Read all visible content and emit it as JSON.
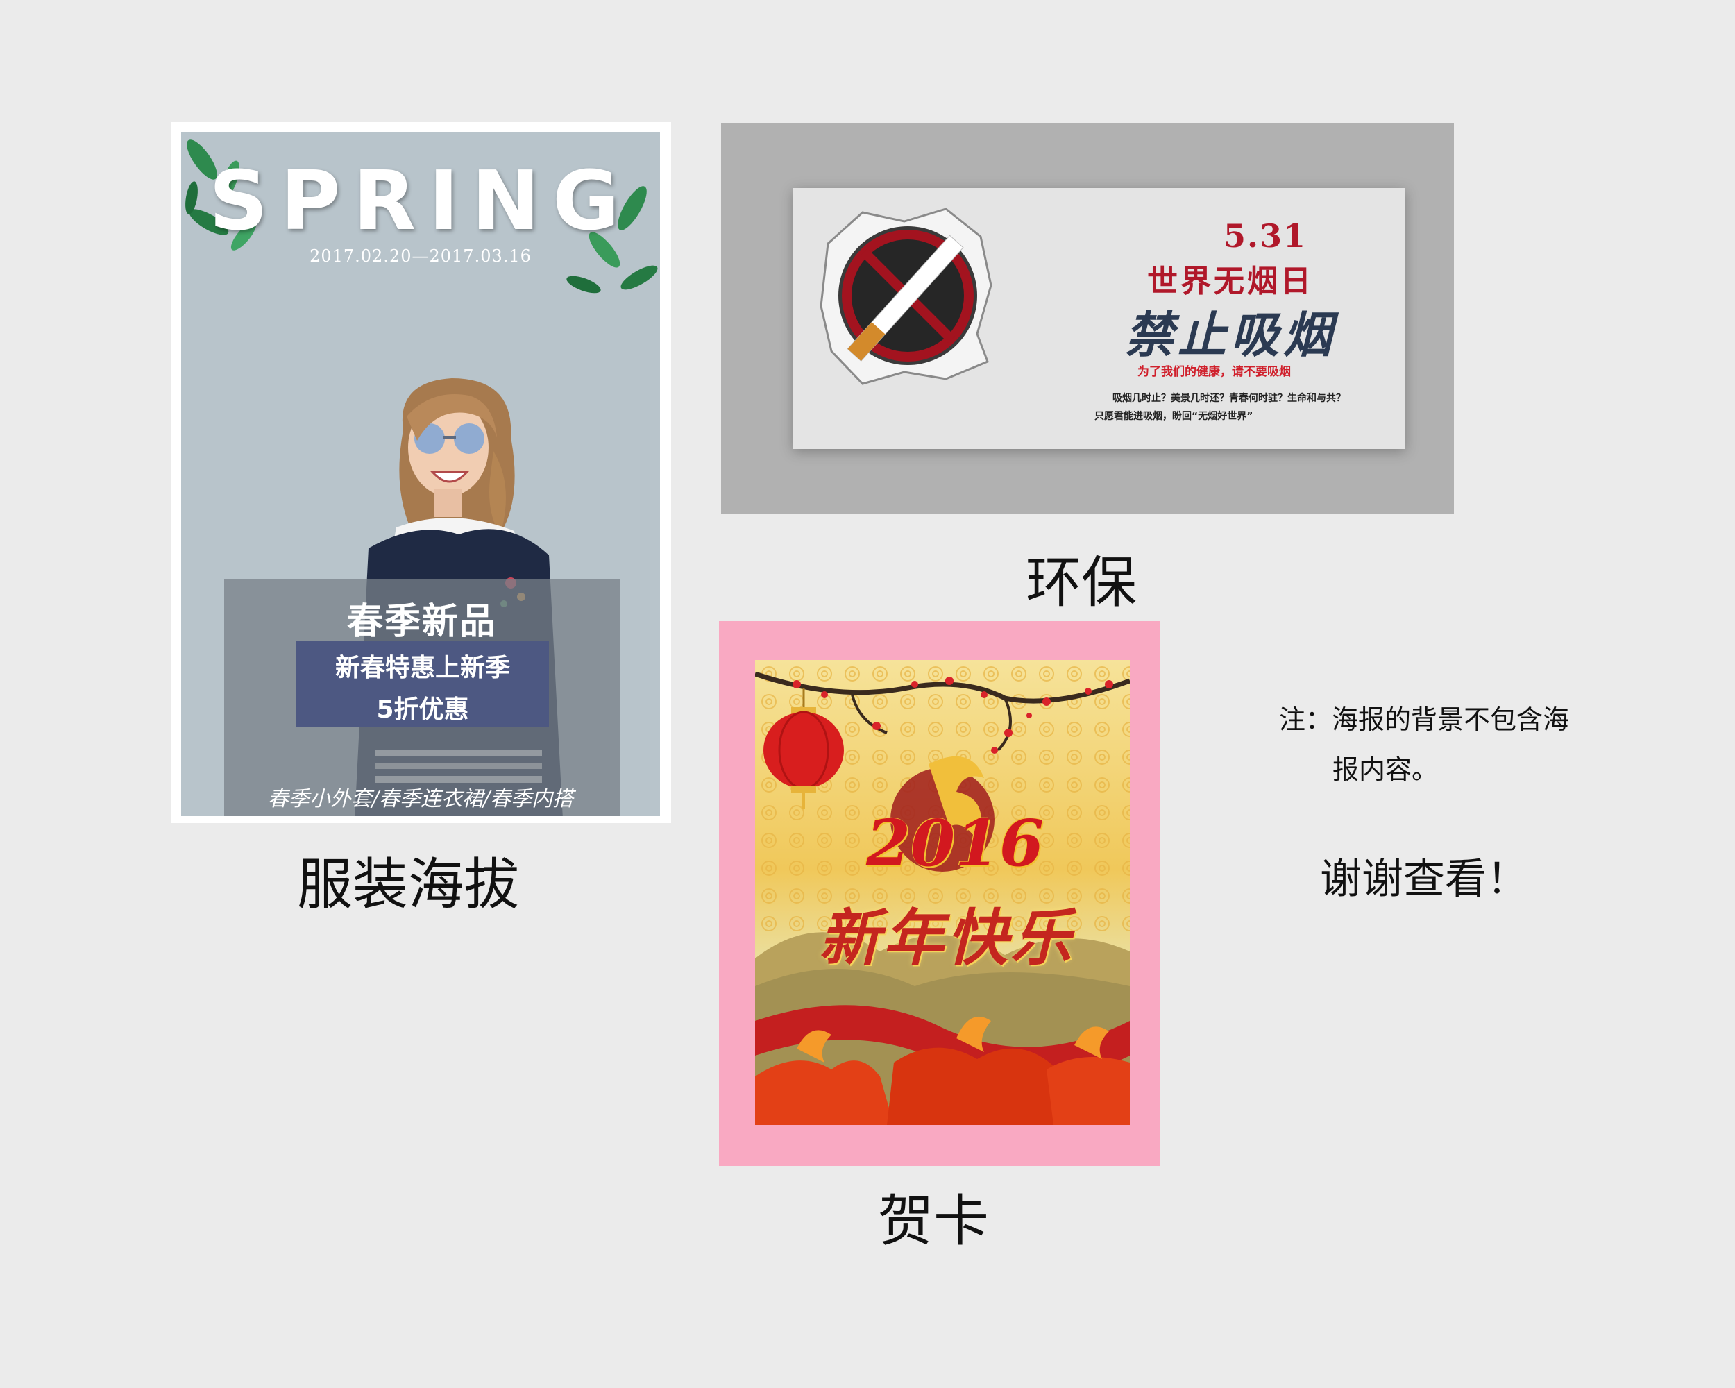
{
  "fashion_poster": {
    "title": "SPRING",
    "date_range": "2017.02.20—2017.03.16",
    "promo_title": "春季新品",
    "promo_line1": "新春特惠上新季",
    "promo_line2": "5折优惠",
    "footer": "春季小外套/春季连衣裙/春季内搭",
    "colors": {
      "background": "#b8c4cb",
      "band": "#4d5882"
    }
  },
  "smoking_poster": {
    "date": "5.31",
    "day_name": "世界无烟日",
    "main_slogan": "禁止吸烟",
    "sub_slogan": "为了我们的健康，请不要吸烟",
    "body_line1": "吸烟几时止？美景几时还？青春何时驻？生命和与共？",
    "body_line2": "只愿君能进吸烟，盼回“无烟好世界”",
    "colors": {
      "accent": "#b0182a",
      "slogan": "#2b3a52"
    }
  },
  "greeting_card": {
    "year": "2016",
    "greeting": "新年快乐",
    "colors": {
      "frame": "#f9a9c2"
    }
  },
  "captions": {
    "fashion": "服装海拔",
    "eco": "环保",
    "card": "贺卡"
  },
  "note": {
    "line1": "注：海报的背景不包含海",
    "line2": "报内容。"
  },
  "thanks": "谢谢查看！"
}
